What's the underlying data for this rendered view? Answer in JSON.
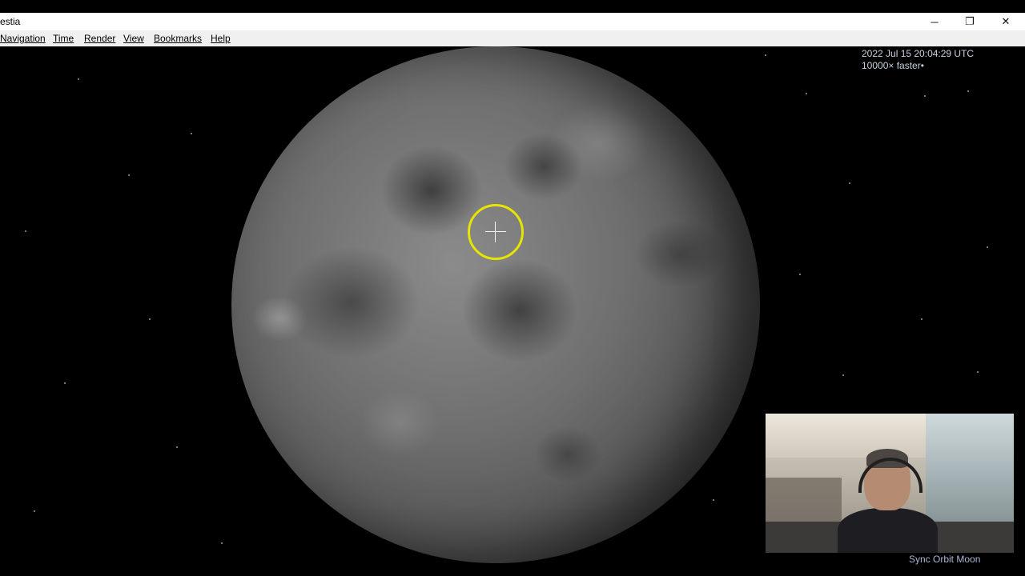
{
  "window": {
    "title": "estia",
    "controls": {
      "minimize": "─",
      "restore": "❐",
      "close": "✕"
    }
  },
  "menu": {
    "items": [
      "Navigation",
      "Time",
      "Render",
      "View",
      "Bookmarks",
      "Help"
    ]
  },
  "hud": {
    "datetime": "2022 Jul 15 20:04:29 UTC",
    "time_rate": "10000× faster•"
  },
  "status": {
    "sync_orbit": "Sync Orbit Moon"
  },
  "colors": {
    "reticle": "#e6e400",
    "hud_text": "#c8d0e0",
    "status_text": "#a9b6d6"
  },
  "icons": {
    "minimize": "minimize-icon",
    "restore": "restore-icon",
    "close": "close-icon",
    "target": "target-reticle-icon"
  }
}
